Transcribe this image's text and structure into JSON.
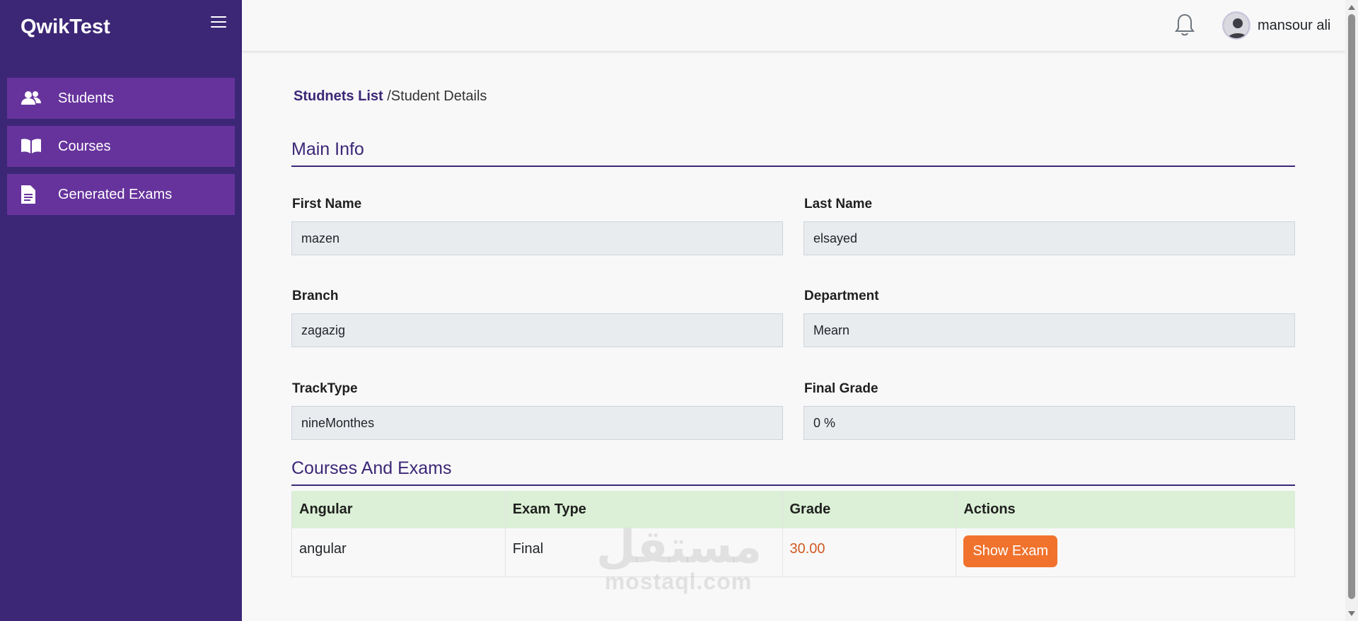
{
  "sidebar": {
    "brand": "QwikTest",
    "items": [
      {
        "label": "Students",
        "icon": "users-icon"
      },
      {
        "label": "Courses",
        "icon": "book-open-icon"
      },
      {
        "label": "Generated Exams",
        "icon": "file-text-icon"
      }
    ]
  },
  "header": {
    "user_name": "mansour ali",
    "notification_icon": "bell-icon",
    "avatar_icon": "user-avatar-icon"
  },
  "breadcrumb": {
    "link": "Studnets List",
    "current": "/Student Details"
  },
  "main_info": {
    "title": "Main Info",
    "fields": {
      "first_name": {
        "label": "First Name",
        "value": "mazen"
      },
      "last_name": {
        "label": "Last Name",
        "value": "elsayed"
      },
      "branch": {
        "label": "Branch",
        "value": "zagazig"
      },
      "department": {
        "label": "Department",
        "value": "Mearn"
      },
      "track_type": {
        "label": "TrackType",
        "value": "nineMonthes"
      },
      "final_grade": {
        "label": "Final Grade",
        "value": "0 %"
      }
    }
  },
  "courses": {
    "title": "Courses And Exams",
    "columns": [
      "Angular",
      "Exam Type",
      "Grade",
      "Actions"
    ],
    "rows": [
      {
        "course": "angular",
        "exam_type": "Final",
        "grade": "30.00",
        "action": "Show Exam"
      }
    ]
  },
  "watermark": {
    "arabic": "مستقل",
    "latin": "mostaql.com"
  },
  "colors": {
    "sidebar": "#3c2776",
    "nav_item": "#66339c",
    "accent": "#3c2776",
    "table_header": "#dbf0d6",
    "grade": "#d05a22",
    "button": "#f0722d"
  }
}
